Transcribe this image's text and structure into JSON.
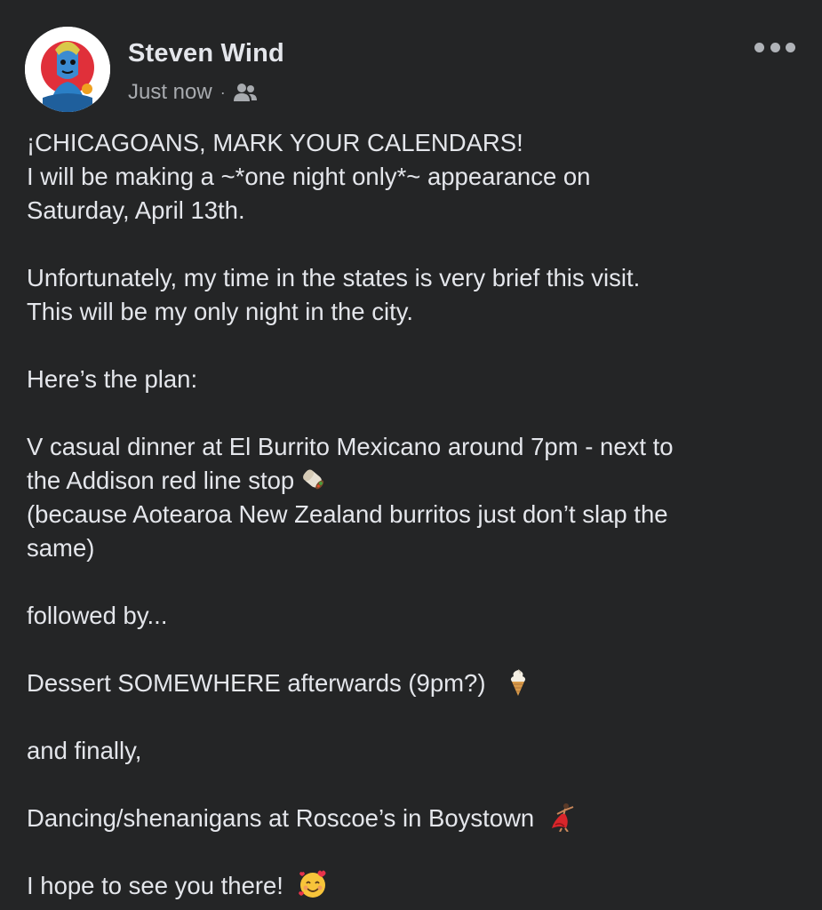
{
  "post": {
    "author": "Steven Wind",
    "timestamp": "Just now",
    "separator": "·",
    "audience_icon": "friends-icon",
    "more_icon": "more-options-icon",
    "lines": {
      "l1": "¡CHICAGOANS, MARK YOUR CALENDARS!",
      "l2": "I will be making a ~*one night only*~ appearance on",
      "l3": "Saturday, April 13th.",
      "l4": "Unfortunately, my time in the states is very brief this visit.",
      "l5": "This will be my only night in the city.",
      "l6": "Here’s the plan:",
      "l7": "V casual dinner at El Burrito Mexicano around 7pm - next to",
      "l8": "the Addison red line stop",
      "l9": "(because Aotearoa New Zealand burritos just don’t slap the",
      "l10": "same)",
      "l11": "followed by...",
      "l12": "Dessert SOMEWHERE afterwards (9pm?)",
      "l13": "and finally,",
      "l14": "Dancing/shenanigans at Roscoe’s in Boystown",
      "l15": "I hope to see you there!"
    },
    "emojis": {
      "burrito": "burrito-icon",
      "ice_cream": "soft-ice-cream-icon",
      "dancer": "dancer-icon",
      "smiling_hearts": "smiling-face-with-hearts-icon"
    }
  }
}
